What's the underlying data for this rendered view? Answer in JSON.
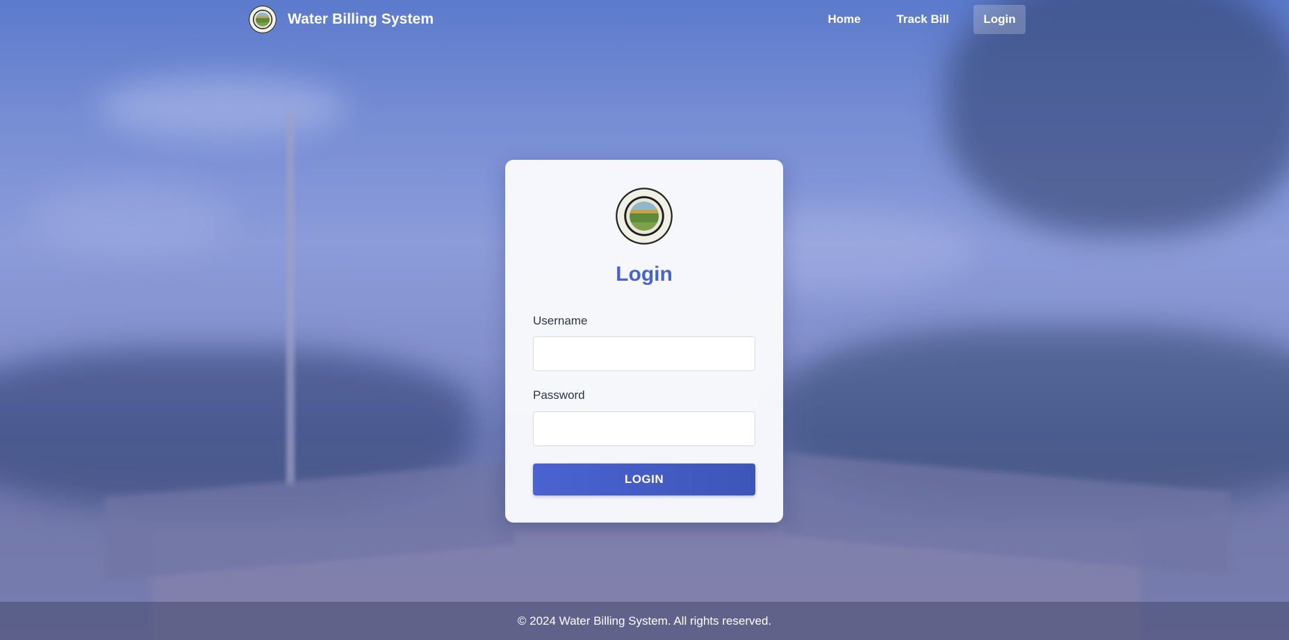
{
  "header": {
    "brand_name": "Water Billing System",
    "logo_icon": "municipal-seal-icon",
    "nav": [
      {
        "label": "Home",
        "active": false
      },
      {
        "label": "Track Bill",
        "active": false
      },
      {
        "label": "Login",
        "active": true
      }
    ]
  },
  "login_card": {
    "logo_icon": "municipal-seal-icon",
    "heading": "Login",
    "username_label": "Username",
    "username_value": "",
    "password_label": "Password",
    "password_value": "",
    "submit_label": "LOGIN"
  },
  "footer": {
    "text": "© 2024 Water Billing System. All rights reserved."
  },
  "colors": {
    "accent": "#4a63c9",
    "button": "#4259c4",
    "text_dark": "#2e3440",
    "white": "#ffffff"
  }
}
